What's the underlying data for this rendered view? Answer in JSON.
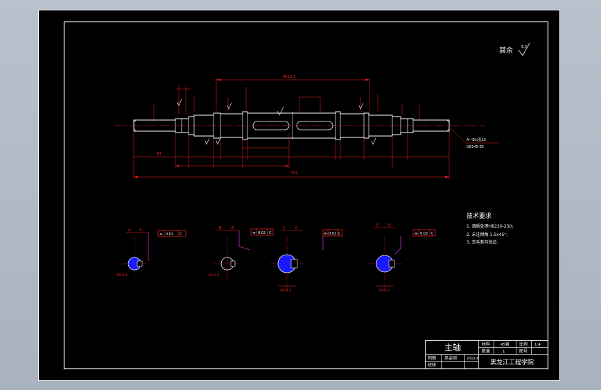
{
  "roughness": {
    "label": "其余",
    "value": "6.3"
  },
  "shaft": {
    "dims": {
      "overall_length": "551",
      "key_length": "80±0.1",
      "end_section": "64",
      "center_hole": "A—B公孔15",
      "center_hole_std": "GB145-85"
    }
  },
  "tech": {
    "title": "技术要求",
    "items": [
      "1. 调质处理HB220-250;",
      "2. 未注倒角 1.5x45°;",
      "3. 去毛刺与锐边."
    ]
  },
  "sections": [
    {
      "cut": "A",
      "tol": [
        "⌯",
        "0.02",
        "C"
      ],
      "dim": "18-0.2"
    },
    {
      "cut": "B",
      "tol": [
        "⌯",
        "0.02",
        "C"
      ],
      "dim": "24-0.2"
    },
    {
      "cut": "C",
      "tol": [
        "⌯",
        "0.02",
        "C"
      ],
      "dim": "36-0.2"
    },
    {
      "cut": "D",
      "tol": [
        "⌯",
        "0.02",
        "C"
      ],
      "dim": "30-0.2"
    }
  ],
  "title_block": {
    "part_name": "主轴",
    "material_label": "材料",
    "material_value": "45钢",
    "scale_label": "比例",
    "scale_value": "1:4",
    "qty_label": "数量",
    "qty_value": "1",
    "drawing_label": "图号",
    "designer_label": "制图",
    "designer_name": "吴金刚",
    "date": "2013.6",
    "checker_label": "校核",
    "school": "黑龙江工程学院"
  },
  "colors": {
    "background": "#000000",
    "border": "#ffffff",
    "outline": "#ffffff",
    "dimension": "#ff2020",
    "center_line": "#ff2020",
    "hatch_fill": "#1a1aff",
    "leader": "#ff40ff",
    "tolerance_box": "#ff2020"
  }
}
